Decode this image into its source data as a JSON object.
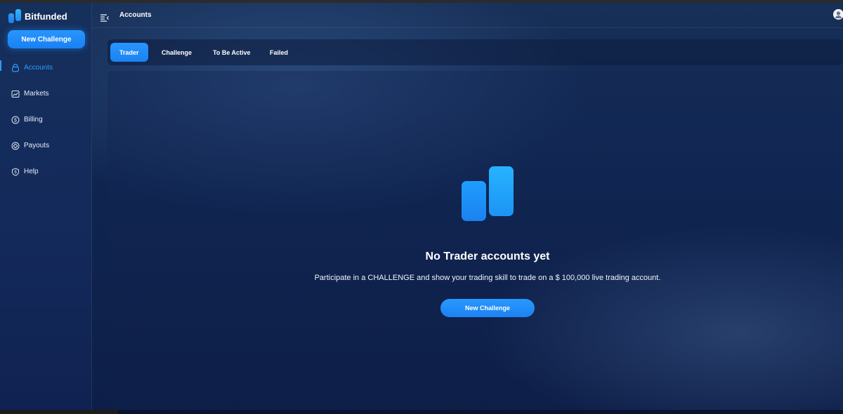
{
  "brand": {
    "name": "Bitfunded",
    "icon": "bitfunded-logo"
  },
  "sidebar": {
    "cta_label": "New Challenge",
    "items": [
      {
        "label": "Accounts",
        "icon": "bag-icon",
        "active": true
      },
      {
        "label": "Markets",
        "icon": "chart-icon",
        "active": false
      },
      {
        "label": "Billing",
        "icon": "dollar-icon",
        "active": false
      },
      {
        "label": "Payouts",
        "icon": "payout-icon",
        "active": false
      },
      {
        "label": "Help",
        "icon": "shield-icon",
        "active": false
      }
    ]
  },
  "header": {
    "title": "Accounts",
    "menu_icon": "menu-icon",
    "avatar_icon": "user-avatar-icon"
  },
  "tabs": [
    {
      "label": "Trader",
      "active": true
    },
    {
      "label": "Challenge",
      "active": false
    },
    {
      "label": "To Be Active",
      "active": false
    },
    {
      "label": "Failed",
      "active": false
    }
  ],
  "empty_state": {
    "title": "No Trader accounts yet",
    "description": "Participate in a CHALLENGE and show your trading skill to trade on a $ 100,000 live trading account.",
    "cta_label": "New Challenge"
  },
  "colors": {
    "accent": "#1e8bfa",
    "background": "#0f2550",
    "text": "#ffffff"
  }
}
